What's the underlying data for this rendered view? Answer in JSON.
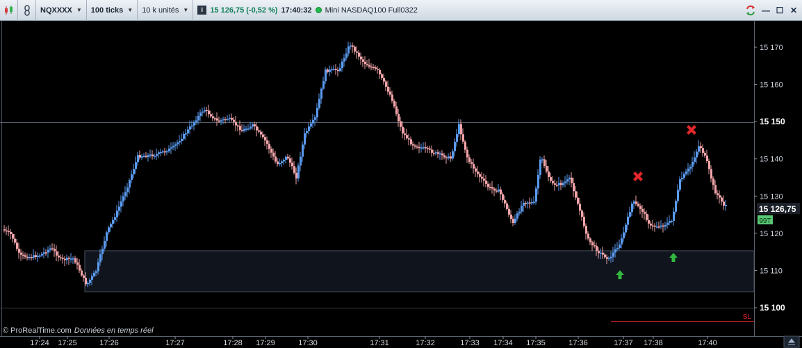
{
  "toolbar": {
    "symbol": "NQXXXX",
    "interval": "100 ticks",
    "units": "10 k unités",
    "quote": "15 126,75 (-0,52 %)",
    "time": "17:40:32",
    "instrument": "Mini NASDAQ100 Full0322"
  },
  "chart": {
    "price_ticks": [
      "15 170",
      "15 160",
      "15 150",
      "15 140",
      "15 130",
      "15 120",
      "15 110",
      "15 100"
    ],
    "bold_ticks": [
      "15 150",
      "15 100"
    ],
    "current_price_label": "15 126,75",
    "tick_counter": "99T",
    "sl_label": "SL",
    "time_labels": [
      "17:24",
      "17:25",
      "17:26",
      "17:27",
      "17:28",
      "17:29",
      "17:30",
      "17:31",
      "17:32",
      "17:33",
      "17:34",
      "17:35",
      "17:36",
      "17:37",
      "17:38",
      "17:40"
    ],
    "credit_main": "© ProRealTime.com",
    "credit_italic": "Données en temps réel",
    "colors": {
      "up": "#5b9bf0",
      "down": "#f2a5a9",
      "sl": "#e02525",
      "tag": "#58c874"
    },
    "markers": [
      "green-up-arrow",
      "green-up-arrow",
      "red-cross",
      "red-cross"
    ]
  }
}
